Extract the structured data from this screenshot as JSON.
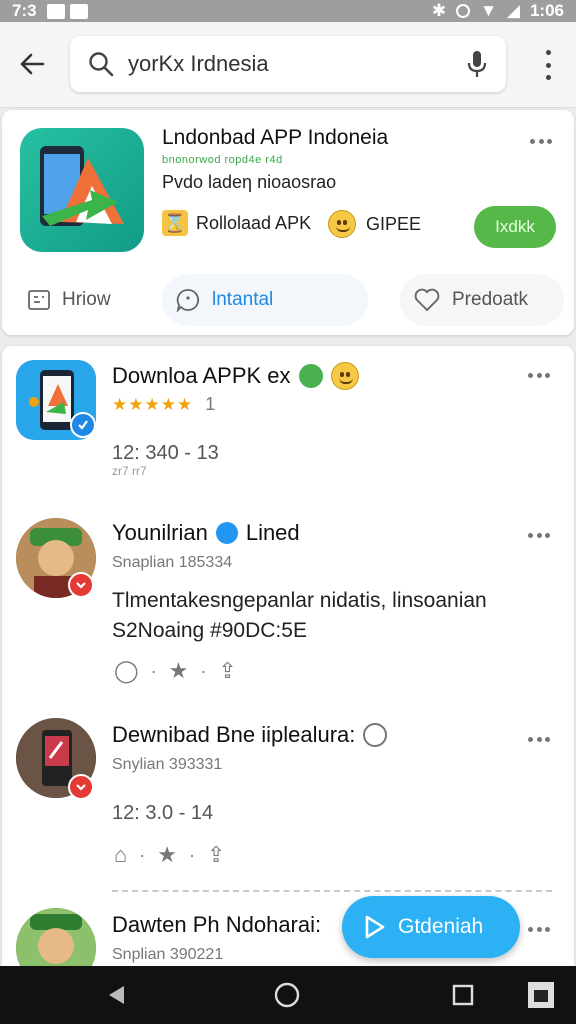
{
  "status_bar": {
    "time": "7:3",
    "clock_right": "1:06"
  },
  "search": {
    "query": "yorKx Irdnesia"
  },
  "featured": {
    "title": "Lndonbad APP Indoneia",
    "green_subtitle": "bnonorwod ropd4e r4d",
    "description": "Pvdo ladeη nioaosrao",
    "meta1": "Rollolaad APK",
    "meta2": "GIPEE",
    "install_label": "Ixdkk",
    "tabs": [
      {
        "label": "Hriow",
        "icon": "grid-icon"
      },
      {
        "label": "lntantal",
        "icon": "chat-icon"
      },
      {
        "label": "Predoatk",
        "icon": "heart-icon"
      }
    ]
  },
  "posts": [
    {
      "title": "Downloa APPK ex",
      "rating": "★★★★★",
      "rating_count": "1",
      "meta": "12: 340 - 13",
      "meta_sub": "zr7   rr7"
    },
    {
      "title": "Younilrian",
      "title_suffix": "Lined",
      "subtitle": "Snaplian 185334",
      "body": "Tlmentakesngepanlar nidatis, linsoanian S2Noaing #90DC:5E"
    },
    {
      "title": "Dewnibad Bne iiplealura:",
      "subtitle": "Snylian 393331",
      "meta": "12: 3.0 - 14"
    },
    {
      "title": "Dawten Ph Ndoharai:",
      "subtitle": "Snplian 390221"
    }
  ],
  "fab": {
    "label": "Gtdeniah"
  },
  "colors": {
    "install_green": "#55b848",
    "fab_blue": "#2bb1f4",
    "tab_active": "#1e88e5",
    "badge_red": "#e53935"
  }
}
